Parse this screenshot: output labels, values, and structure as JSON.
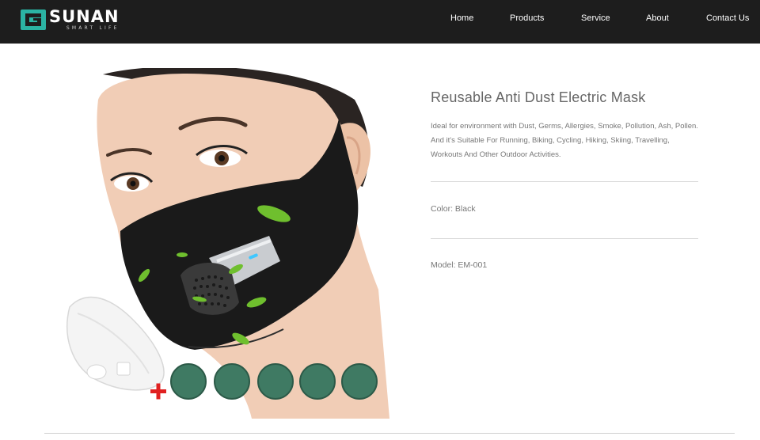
{
  "brand": {
    "name": "SUNAN",
    "tagline": "SMART LIFE",
    "accent_color": "#2bb3a3"
  },
  "nav": {
    "items": [
      "Home",
      "Products",
      "Service",
      "About",
      "Contact Us"
    ]
  },
  "product": {
    "title": "Reusable Anti Dust Electric Mask",
    "description": "Ideal for environment with Dust, Germs, Allergies, Smoke, Pollution, Ash, Pollen. And it's Suitable For Running, Biking, Cycling, Hiking, Skiing, Travelling, Workouts And Other Outdoor Activities.",
    "color": "Color: Black",
    "model": "Model: EM-001",
    "image": {
      "subject": "woman-wearing-black-electric-mask-with-filters",
      "filter_count": 5,
      "plus_symbol": "+"
    }
  },
  "colors": {
    "header_bg": "#1d1d1d",
    "mask": "#1a1a1a",
    "filter": "#3f7a63",
    "leaf": "#6fbf2e",
    "plus": "#e02020"
  }
}
